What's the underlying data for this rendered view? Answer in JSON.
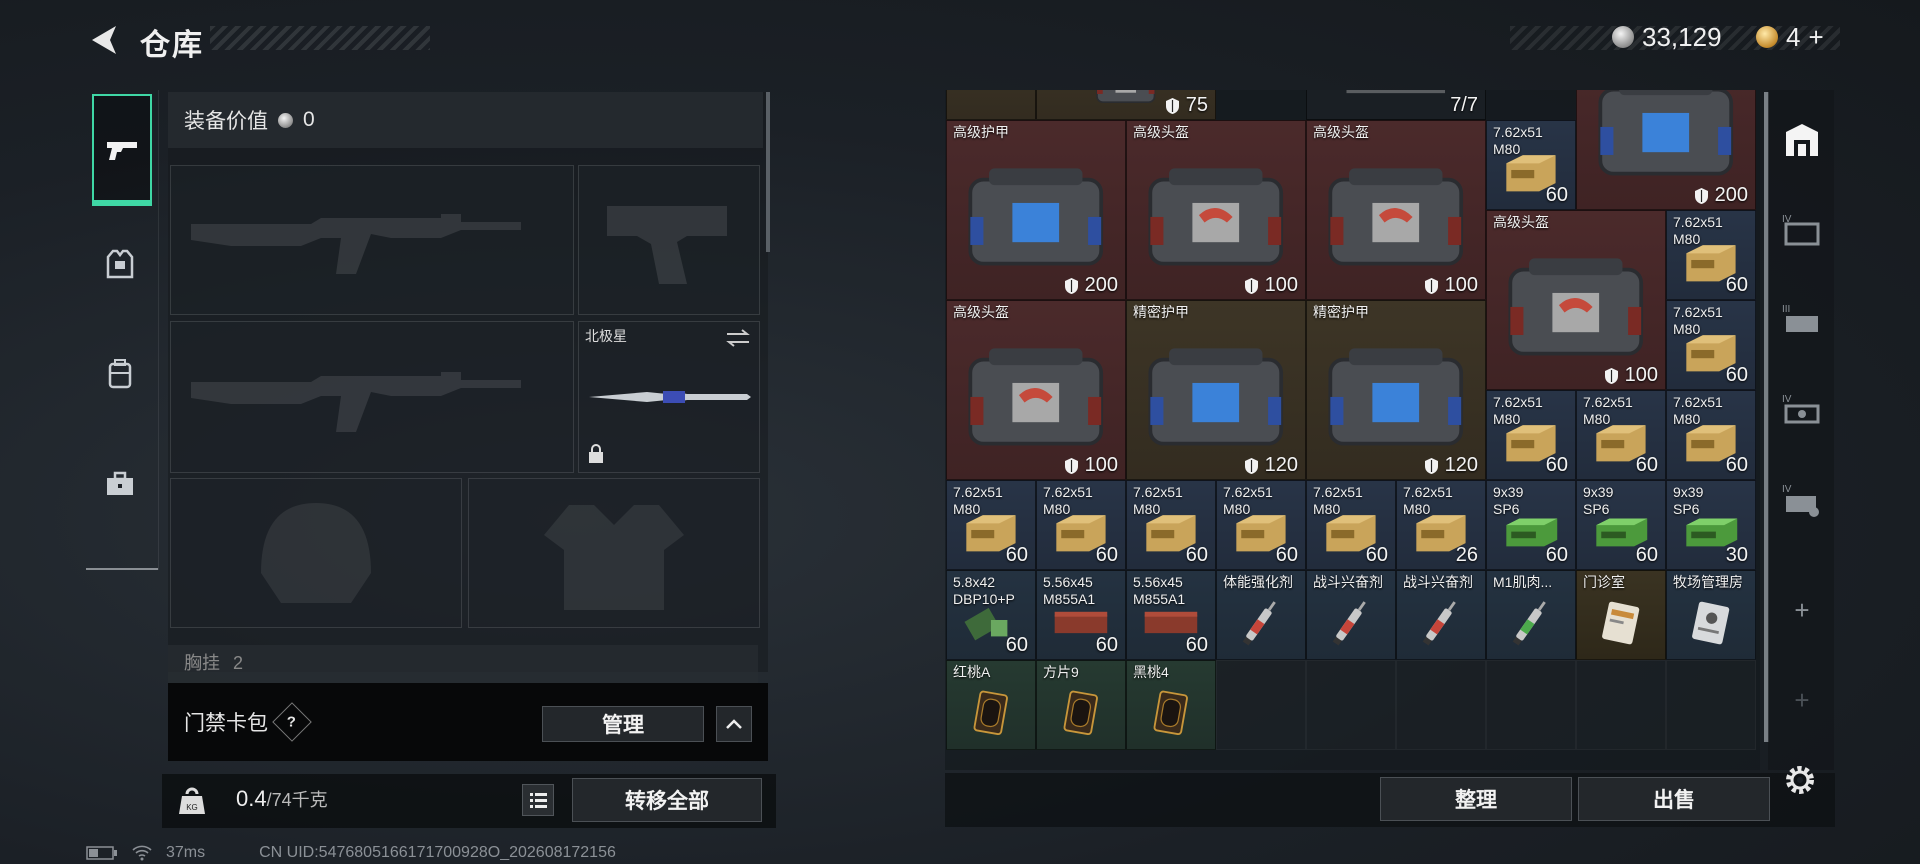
{
  "header": {
    "title": "仓库",
    "silver_amount": "33,129",
    "gold_amount": "4",
    "gold_plus": "+"
  },
  "left_panel": {
    "equip_value_label": "装备价值",
    "equip_value": "0",
    "melee_slot_name": "北极星",
    "chest_rig_label": "胸挂",
    "chest_rig_count": "2",
    "keycard_label": "门禁卡包",
    "keycard_help": "?",
    "manage_button": "管理",
    "weight_current": "0.4",
    "weight_max": "/74千克",
    "transfer_all_button": "转移全部"
  },
  "status_bar": {
    "latency": "37ms",
    "uid": "CN UID:5476805166171700928O_202608172156"
  },
  "warehouse": {
    "items": [
      {
        "name": "",
        "count": "",
        "color": "brown"
      },
      {
        "name": "",
        "count": "75",
        "color": "brown"
      },
      {
        "name": "",
        "count": "7/7",
        "color": "dark"
      },
      {
        "name": "",
        "count": "200",
        "color": "red"
      },
      {
        "name": "高级护甲",
        "count": "200",
        "color": "red"
      },
      {
        "name": "高级头盔",
        "count": "100",
        "color": "red"
      },
      {
        "name": "高级头盔",
        "count": "100",
        "color": "red"
      },
      {
        "name": "7.62x51\nM80",
        "count": "60",
        "color": "blue"
      },
      {
        "name": "高级头盔",
        "count": "100",
        "color": "red"
      },
      {
        "name": "7.62x51\nM80",
        "count": "60",
        "color": "blue"
      },
      {
        "name": "7.62x51\nM80",
        "count": "60",
        "color": "blue"
      },
      {
        "name": "高级头盔",
        "count": "100",
        "color": "red"
      },
      {
        "name": "精密护甲",
        "count": "120",
        "color": "brown"
      },
      {
        "name": "精密护甲",
        "count": "120",
        "color": "brown"
      },
      {
        "name": "7.62x51\nM80",
        "count": "60",
        "color": "blue"
      },
      {
        "name": "7.62x51\nM80",
        "count": "60",
        "color": "blue"
      },
      {
        "name": "7.62x51\nM80",
        "count": "60",
        "color": "blue"
      },
      {
        "name": "7.62x51\nM80",
        "count": "60",
        "color": "blue"
      },
      {
        "name": "7.62x51\nM80",
        "count": "60",
        "color": "blue"
      },
      {
        "name": "7.62x51\nM80",
        "count": "60",
        "color": "blue"
      },
      {
        "name": "7.62x51\nM80",
        "count": "60",
        "color": "blue"
      },
      {
        "name": "7.62x51\nM80",
        "count": "60",
        "color": "blue"
      },
      {
        "name": "7.62x51\nM80",
        "count": "26",
        "color": "blue"
      },
      {
        "name": "9x39\nSP6",
        "count": "60",
        "color": "blue"
      },
      {
        "name": "9x39\nSP6",
        "count": "60",
        "color": "blue"
      },
      {
        "name": "9x39\nSP6",
        "count": "30",
        "color": "blue"
      },
      {
        "name": "5.8x42\nDBP10+P",
        "count": "60",
        "color": "teal"
      },
      {
        "name": "5.56x45\nM855A1",
        "count": "60",
        "color": "teal"
      },
      {
        "name": "5.56x45\nM855A1",
        "count": "60",
        "color": "teal"
      },
      {
        "name": "体能强化剂",
        "count": "",
        "color": "teal"
      },
      {
        "name": "战斗兴奋剂",
        "count": "",
        "color": "teal"
      },
      {
        "name": "战斗兴奋剂",
        "count": "",
        "color": "teal"
      },
      {
        "name": "M1肌肉...",
        "count": "",
        "color": "teal"
      },
      {
        "name": "门诊室",
        "count": "",
        "color": "gold"
      },
      {
        "name": "牧场管理房",
        "count": "",
        "color": "teal"
      },
      {
        "name": "红桃A",
        "count": "",
        "color": "green"
      },
      {
        "name": "方片9",
        "count": "",
        "color": "green"
      },
      {
        "name": "黑桃4",
        "count": "",
        "color": "green"
      }
    ],
    "sort_button": "整理",
    "sell_button": "出售"
  },
  "right_rail": {
    "plus_1": "+",
    "plus_2": "+"
  },
  "colors": {
    "accent": "#3fd7a5",
    "red_cell": "#4b2a2b",
    "brown_cell": "#3d3526",
    "blue_cell": "#283447"
  }
}
